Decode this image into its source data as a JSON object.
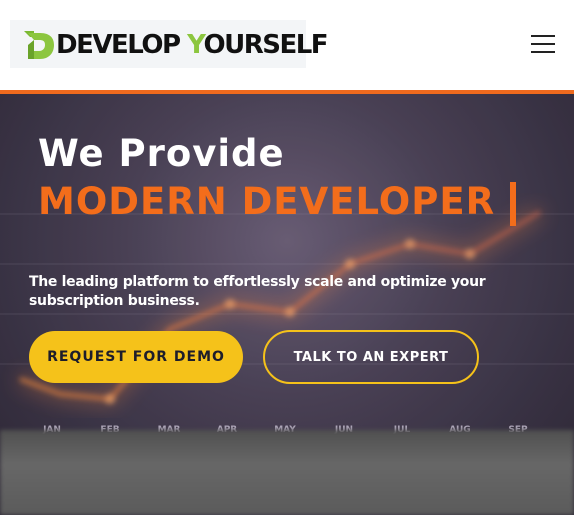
{
  "header": {
    "logo_text_a": "DEVELOP ",
    "logo_text_y": "Y",
    "logo_text_b": "OURSELF",
    "menu_icon": "hamburger-menu-icon"
  },
  "hero": {
    "title_line1": "We Provide",
    "title_line2": "MODERN DEVELOPER",
    "subtitle": "The leading platform to effortlessly scale and optimize your subscription business.",
    "primary_button": "REQUEST FOR DEMO",
    "secondary_button": "TALK TO AN EXPERT",
    "months": [
      "JAN",
      "FEB",
      "MAR",
      "APR",
      "MAY",
      "JUN",
      "JUL",
      "AUG",
      "SEP"
    ]
  },
  "colors": {
    "accent_orange": "#f36d1b",
    "accent_yellow": "#f5c21a",
    "logo_green": "#8cc63f"
  }
}
